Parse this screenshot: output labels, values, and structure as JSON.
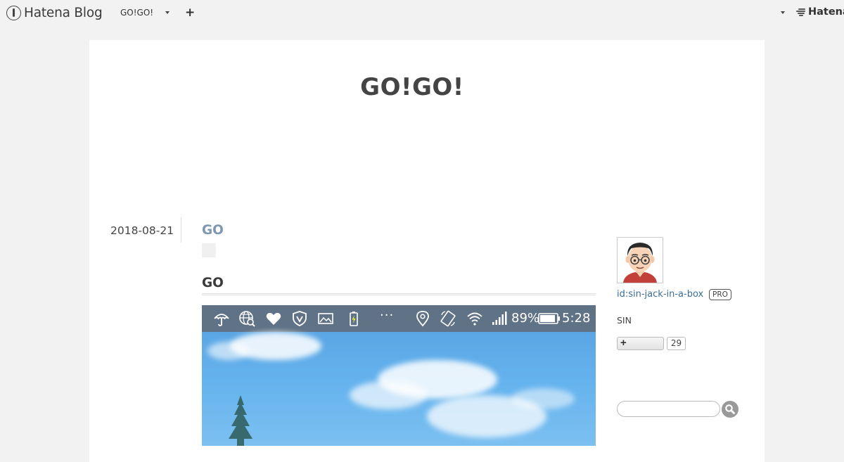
{
  "globalheader": {
    "logo_text": "Hatena Blog",
    "blog_name": "GO!GO!",
    "add_label": "+",
    "right_logo_text": "Hatena"
  },
  "blog": {
    "title": "GO!GO!"
  },
  "entry": {
    "date": "2018-08-21",
    "title": "GO",
    "section_heading": "GO",
    "image": {
      "status_bar": {
        "battery_percent": "89%",
        "time": "5:28",
        "dots": "···"
      }
    }
  },
  "sidebar": {
    "profile": {
      "id_link": "id:sin-jack-in-a-box",
      "badge": "PRO",
      "name": "SIN"
    },
    "subscribe": {
      "plus_label": "+",
      "count": "29"
    },
    "search": {
      "placeholder": ""
    }
  },
  "colors": {
    "background": "#f2f2f2",
    "container": "#ffffff",
    "entry_title": "#7f97b2",
    "link": "#3b6e95",
    "status_bar": "#5f7286",
    "sky": "#5aa6e4"
  },
  "icons": {
    "header": [
      "hatena-logo-icon",
      "caret-down-icon",
      "plus-icon",
      "hatena-stripes-icon"
    ],
    "status_bar": [
      "umbrella-icon",
      "globe-search-icon",
      "heart-icon",
      "shield-icon",
      "image-icon",
      "battery-charging-icon",
      "location-pin-icon",
      "rotate-icon",
      "wifi-icon",
      "signal-icon",
      "battery-icon"
    ],
    "sidebar": [
      "avatar",
      "search-icon"
    ]
  }
}
